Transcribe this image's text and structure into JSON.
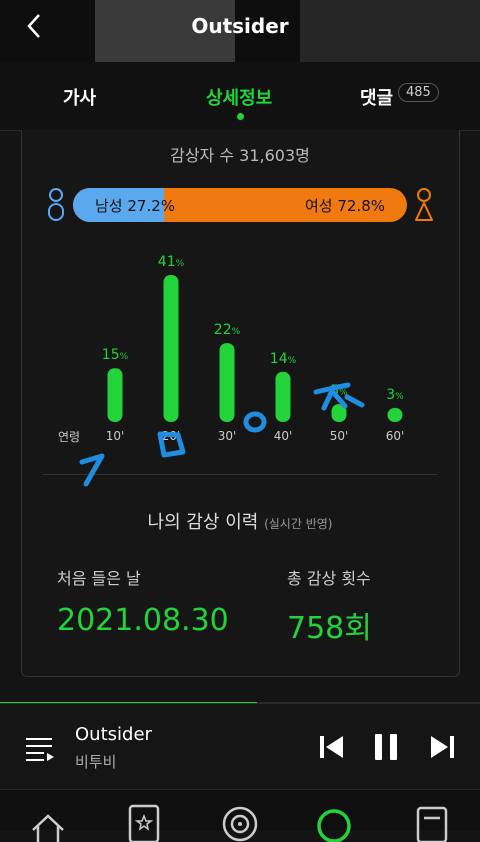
{
  "header": {
    "title": "Outsider"
  },
  "tabs": {
    "lyrics": "가사",
    "detail": "상세정보",
    "comments": "댓글",
    "comment_count": "485"
  },
  "stats": {
    "listeners": "감상자 수 31,603명",
    "male_label": "남성 27.2%",
    "female_label": "여성 72.8%",
    "male_pct": 27.2,
    "female_pct": 72.8,
    "age_axis_label": "연령"
  },
  "chart_data": {
    "type": "bar",
    "categories": [
      "10'",
      "20'",
      "30'",
      "40'",
      "50'",
      "60'"
    ],
    "values": [
      15,
      41,
      22,
      14,
      5,
      3
    ],
    "value_suffix": "%",
    "color": "#22d33a"
  },
  "history": {
    "title": "나의 감상 이력",
    "subtitle": "(실시간 반영)",
    "first_listen_label": "처음 들은 날",
    "first_listen_value": "2021.08.30",
    "total_label": "총 감상 횟수",
    "total_value": "758회"
  },
  "player": {
    "song": "Outsider",
    "artist": "비투비",
    "progress": 0.535
  },
  "colors": {
    "accent": "#22d33a",
    "male": "#5aa8ee",
    "female": "#f07a10"
  }
}
